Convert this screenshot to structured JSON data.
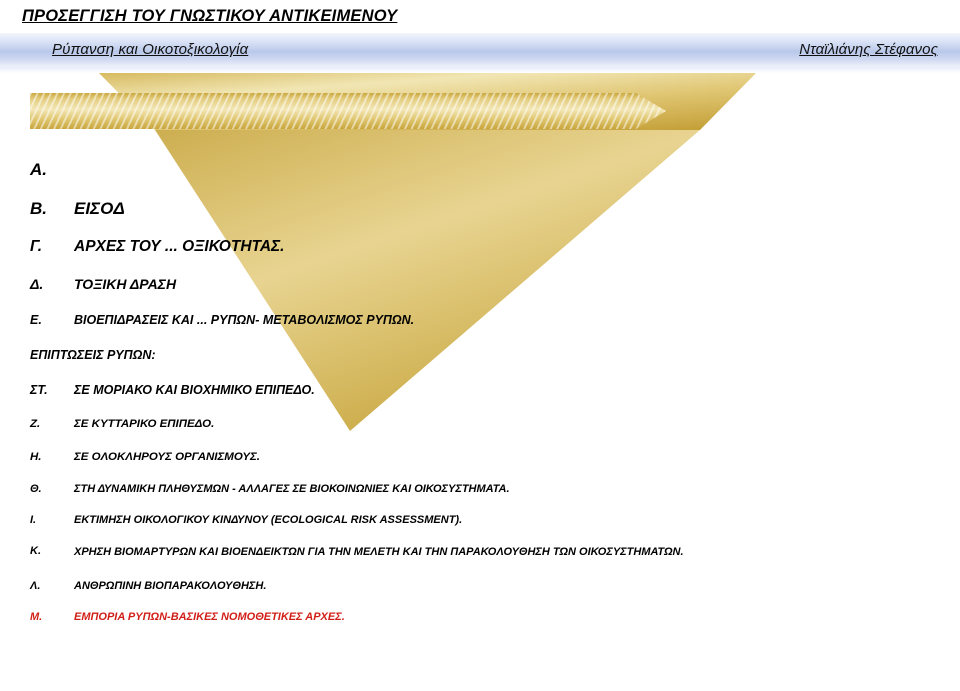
{
  "header": {
    "left_text": "Ρύπανση και Οικοτοξικολογία",
    "right_text": "Νταϊλιάνης Στέφανος"
  },
  "title": {
    "text": "ΠΡΟΣΕΓΓΙΣΗ ΤΟΥ ΓΝΩΣΤΙΚΟΥ ΑΝΤΙΚΕΙΜΕΝΟΥ"
  },
  "colors": {
    "gold_light": "#f3e7b6",
    "gold_mid": "#e0c771",
    "gold_dark": "#c8a53c",
    "header_blue": "#b9c8ea",
    "accent_red": "#d11f18",
    "text_black": "#000000"
  },
  "outline": {
    "items": [
      {
        "marker": "Α.",
        "text": "",
        "occluded": true,
        "color": "black"
      },
      {
        "marker": "Β.",
        "text": "ΕΙΣΟΔ",
        "occluded": true,
        "color": "black"
      },
      {
        "marker": "Γ.",
        "text": "ΑΡΧΕΣ ΤΟΥ ... ΟΞΙΚΟΤΗΤΑΣ.",
        "occluded": true,
        "color": "black"
      },
      {
        "marker": "Δ.",
        "text": "ΤΟΞΙΚΗ ΔΡΑΣΗ",
        "occluded": true,
        "color": "black"
      },
      {
        "marker": "Ε.",
        "text": "ΒΙΟΕΠΙΔΡΑΣΕΙΣ ΚΑΙ ... ΡΥΠΩΝ- ΜΕΤΑΒΟΛΙΣΜΟΣ ΡΥΠΩΝ.",
        "occluded": true,
        "color": "black"
      },
      {
        "marker": "",
        "text": "ΕΠΙΠΤΩΣΕΙΣ ΡΥΠΩΝ:",
        "occluded": false,
        "color": "black"
      },
      {
        "marker": "ΣΤ.",
        "text": "ΣΕ ΜΟΡΙΑΚΟ ΚΑΙ ΒΙΟΧΗΜΙΚΟ ΕΠΙΠΕΔΟ.",
        "occluded": true,
        "color": "black"
      },
      {
        "marker": "Ζ.",
        "text": "ΣΕ ΚΥΤΤΑΡΙΚΟ ΕΠΙΠΕΔΟ.",
        "occluded": false,
        "color": "black"
      },
      {
        "marker": "Η.",
        "text": "ΣΕ ΟΛΟΚΛΗΡΟΥΣ ΟΡΓΑΝΙΣΜΟΥΣ.",
        "occluded": false,
        "color": "black"
      },
      {
        "marker": "Θ.",
        "text": "ΣΤΗ ΔΥΝΑΜΙΚΗ ΠΛΗΘΥΣΜΩΝ - ΑΛΛΑΓΕΣ ΣΕ ΒΙΟΚΟΙΝΩΝΙΕΣ ΚΑΙ ΟΙΚΟΣΥΣΤΗΜΑΤΑ.",
        "occluded": false,
        "color": "black"
      },
      {
        "marker": "Ι.",
        "text": "ΕΚΤΙΜΗΣΗ ΟΙΚΟΛΟΓΙΚΟΥ ΚΙΝΔΥΝΟΥ (ECOLOGICAL RISK ASSESSMENT).",
        "occluded": false,
        "color": "black"
      },
      {
        "marker": "Κ.",
        "text": "ΧΡΗΣΗ ΒΙΟΜΑΡΤΥΡΩΝ ΚΑΙ ΒΙΟΕΝΔΕΙΚΤΩΝ ΓΙΑ ΤΗΝ ΜΕΛΕΤΗ ΚΑΙ ΤΗΝ ΠΑΡΑΚΟΛΟΥΘΗΣΗ ΤΩΝ ΟΙΚΟΣΥΣΤΗΜΑΤΩΝ.",
        "occluded": false,
        "color": "black"
      },
      {
        "marker": "Λ.",
        "text": "ΑΝΘΡΩΠΙΝΗ ΒΙΟΠΑΡΑΚΟΛΟΥΘΗΣΗ.",
        "occluded": false,
        "color": "black"
      },
      {
        "marker": "Μ.",
        "text": "ΕΜΠΟΡΙΑ ΡΥΠΩΝ-ΒΑΣΙΚΕΣ ΝΟΜΟΘΕΤΙΚΕΣ ΑΡΧΕΣ.",
        "occluded": false,
        "color": "red"
      }
    ]
  }
}
